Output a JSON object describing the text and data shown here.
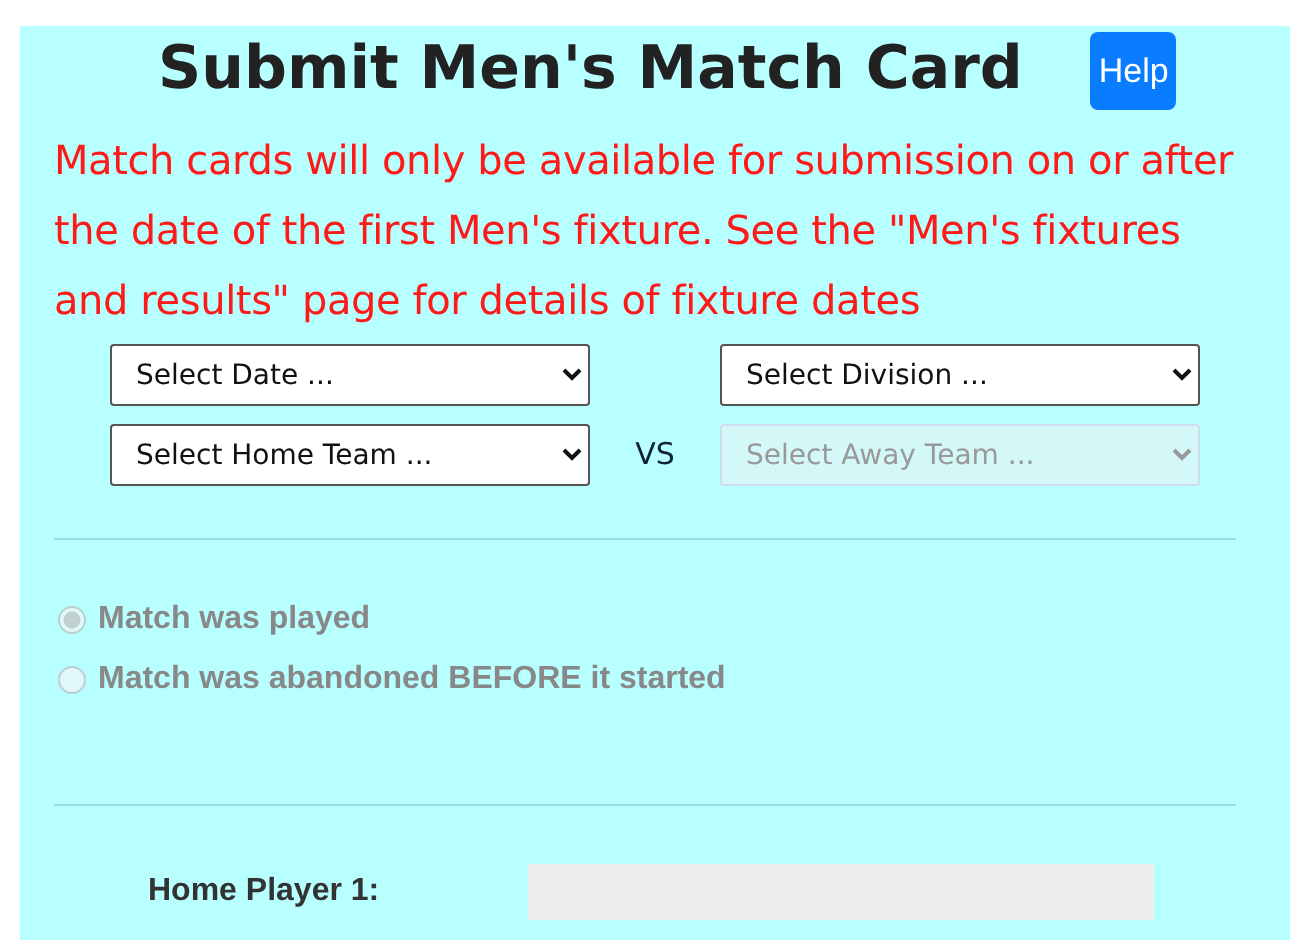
{
  "title": "Submit Men's Match Card",
  "help_button": "Help",
  "notice": "Match cards will only be available for submission on or after the date of the first Men's fixture. See the \"Men's fixtures and results\" page for details of fixture dates",
  "selects": [
    {
      "value": "Select Date ...",
      "disabled": false
    },
    {
      "value": "Select Division ...",
      "disabled": false
    },
    {
      "value": "Select Home Team ...",
      "disabled": false
    },
    {
      "value": "Select Away Team ...",
      "disabled": true
    }
  ],
  "vs_label": "VS",
  "match_status": [
    {
      "label": "Match was played",
      "selected": true,
      "disabled": true
    },
    {
      "label": "Match was abandoned BEFORE it started",
      "selected": false,
      "disabled": true
    }
  ],
  "players": [
    {
      "label": "Home Player 1:",
      "disabled": true
    }
  ]
}
